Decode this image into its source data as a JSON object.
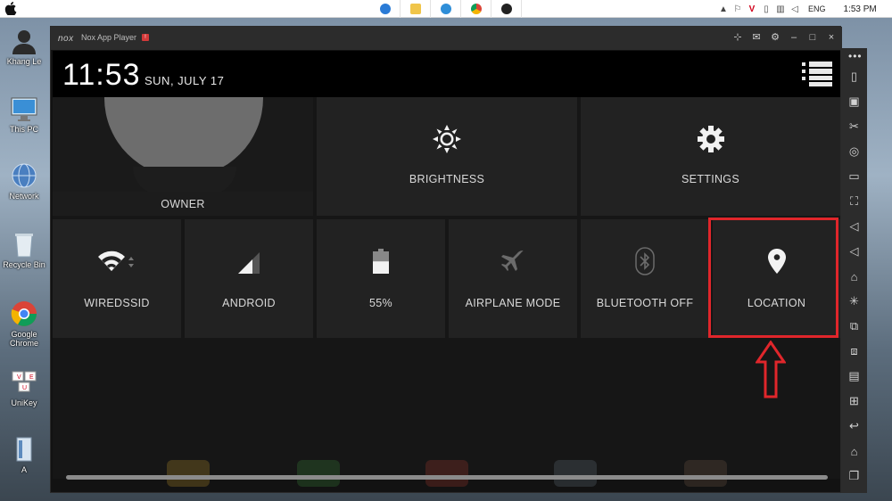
{
  "taskbar": {
    "tray_lang": "ENG",
    "clock": "1:53 PM",
    "apps": [
      "ie-icon",
      "explorer-icon",
      "edge-icon",
      "chrome-icon",
      "nox-icon"
    ]
  },
  "desktop": {
    "icons": [
      {
        "label": "Khang Le",
        "icon": "user-icon"
      },
      {
        "label": "This PC",
        "icon": "monitor-icon"
      },
      {
        "label": "Network",
        "icon": "globe-icon"
      },
      {
        "label": "Recycle Bin",
        "icon": "trash-icon"
      },
      {
        "label": "Google Chrome",
        "icon": "chrome-icon"
      },
      {
        "label": "UniKey",
        "icon": "keyboard-icon"
      },
      {
        "label": "A",
        "icon": "document-icon"
      }
    ]
  },
  "window": {
    "logo": "nox",
    "title": "Nox App Player",
    "badge": "!"
  },
  "status": {
    "time": "11:53",
    "date": "SUN, JULY 17"
  },
  "tiles": {
    "owner": "OWNER",
    "brightness": "BRIGHTNESS",
    "settings": "SETTINGS",
    "wifi": "WIREDSSID",
    "signal": "ANDROID",
    "battery": "55%",
    "airplane": "AIRPLANE MODE",
    "bluetooth": "BLUETOOTH OFF",
    "location": "LOCATION"
  },
  "battery_level": 0.55,
  "colors": {
    "highlight": "#e0262b",
    "tile": "#222222",
    "panel": "#161616"
  }
}
